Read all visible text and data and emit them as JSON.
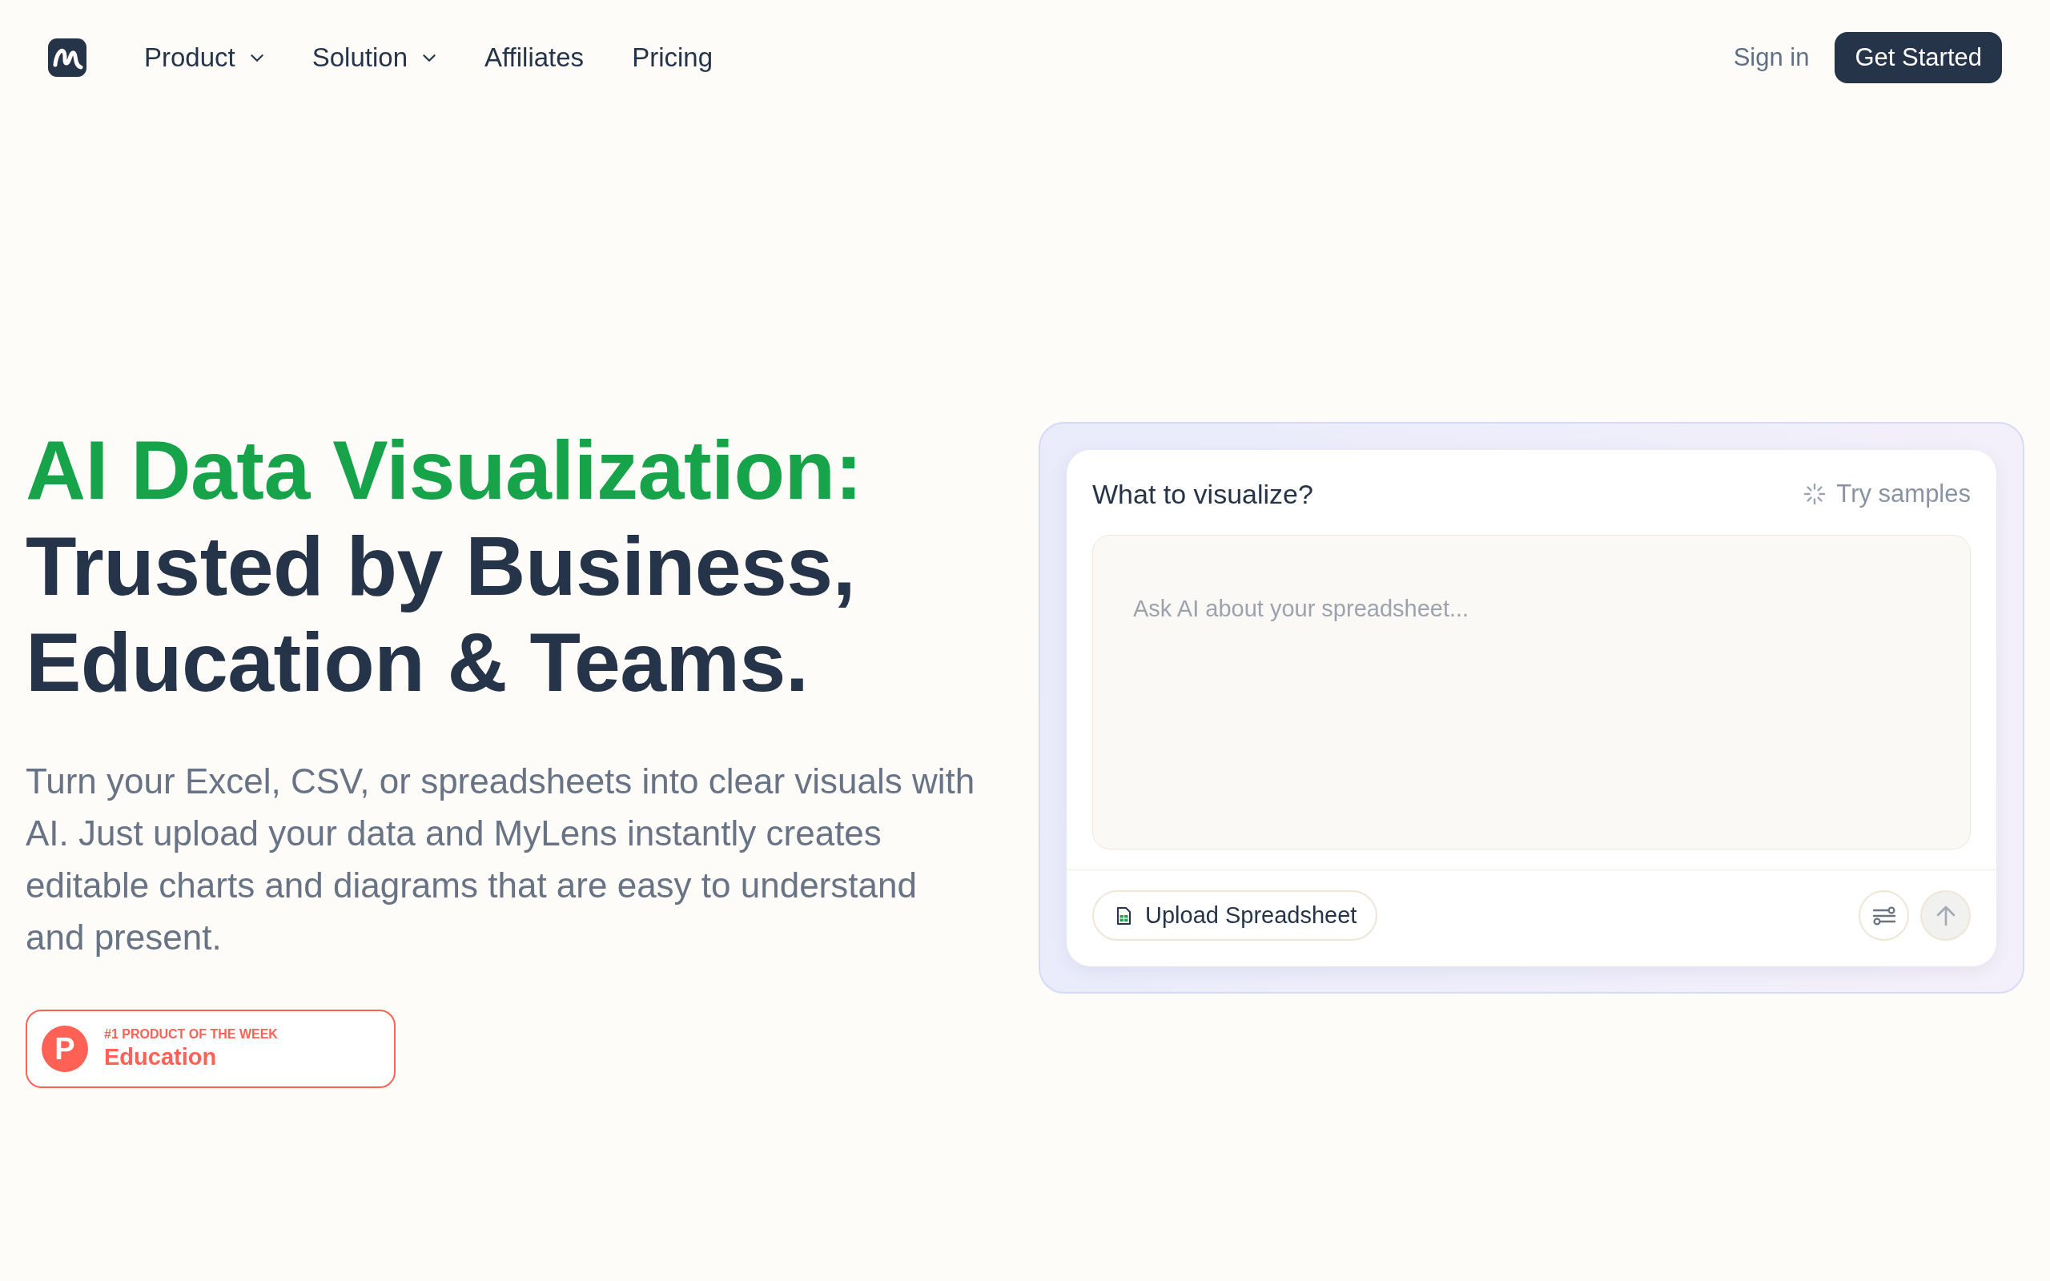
{
  "nav": {
    "links": [
      {
        "label": "Product",
        "has_menu": true
      },
      {
        "label": "Solution",
        "has_menu": true
      },
      {
        "label": "Affiliates",
        "has_menu": false
      },
      {
        "label": "Pricing",
        "has_menu": false
      }
    ],
    "sign_in": "Sign in",
    "cta": "Get Started"
  },
  "hero": {
    "headline": {
      "accent": "AI Data Visualization:",
      "rest": "Trusted by Business, Education & Teams."
    },
    "description": "Turn your Excel, CSV, or spreadsheets into clear visuals with AI. Just upload your data and MyLens instantly creates editable charts and diagrams that are easy to understand and present.",
    "award_badge": {
      "letter": "P",
      "caption": "#1 PRODUCT OF THE WEEK",
      "category": "Education"
    }
  },
  "prompt_card": {
    "title": "What to visualize?",
    "samples_link": "Try samples",
    "prompt_field": {
      "placeholder": "Ask AI about your spreadsheet..."
    },
    "upload_button": "Upload Spreadsheet",
    "send_button": {
      "disabled": true
    }
  }
}
